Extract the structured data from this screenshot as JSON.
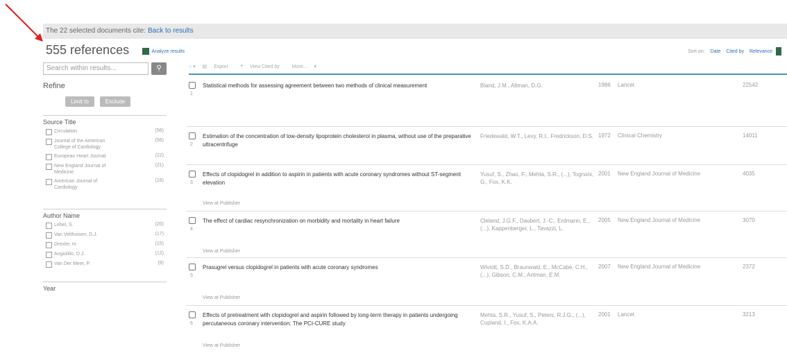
{
  "top_bar": {
    "text": "The 22 selected documents cite:",
    "link": "Back to results"
  },
  "header": {
    "count": "555 references",
    "analyze": "Analyze results"
  },
  "sort": {
    "label": "Sort on:",
    "options": [
      "Date",
      "Cited by",
      "Relevance"
    ]
  },
  "sidebar": {
    "search_placeholder": "Search within results...",
    "refine": "Refine",
    "limit_to": "Limit to",
    "exclude": "Exclude",
    "source_title": {
      "heading": "Source Title",
      "items": [
        {
          "name": "Circulation",
          "count": "(56)"
        },
        {
          "name": "Journal of the American College of Cardiology",
          "count": "(56)"
        },
        {
          "name": "European Heart Journal",
          "count": "(22)"
        },
        {
          "name": "New England Journal of Medicine",
          "count": "(21)"
        },
        {
          "name": "American Journal of Cardiology",
          "count": "(16)"
        }
      ]
    },
    "author_name": {
      "heading": "Author Name",
      "items": [
        {
          "name": "Lebel, S.",
          "count": "(20)"
        },
        {
          "name": "Van Velthuisen, D.J.",
          "count": "(17)"
        },
        {
          "name": "Drexler, H.",
          "count": "(15)"
        },
        {
          "name": "Angiolillo, D.J.",
          "count": "(12)"
        },
        {
          "name": "Van Der Meer, P.",
          "count": "(9)"
        }
      ]
    },
    "year_heading": "Year"
  },
  "toolbar": {
    "export": "Export",
    "view_cited_by": "View Cited by",
    "more": "More..."
  },
  "results": [
    {
      "num": "1",
      "title": "Statistical methods for assessing agreement between two methods of clinical measurement",
      "authors": "Bland, J.M., Altman, D.G.",
      "year": "1986",
      "source": "Lancet",
      "cited": "22542",
      "view": ""
    },
    {
      "num": "2",
      "title": "Estimation of the concentration of low-density lipoprotein cholesterol in plasma, without use of the preparative ultracentrifuge",
      "authors": "Friedewald, W.T., Levy, R.I., Fredrickson, D.S.",
      "year": "1972",
      "source": "Clinical Chemistry",
      "cited": "14011",
      "view": ""
    },
    {
      "num": "3",
      "title": "Effects of clopidogrel in addition to aspirin in patients with acute coronary syndromes without ST-segment elevation",
      "authors": "Yusuf, S., Zhao, F., Mehta, S.R., (...), Tognoni, G., Fox, K.K.",
      "year": "2001",
      "source": "New England Journal of Medicine",
      "cited": "4035",
      "view": "View at Publisher"
    },
    {
      "num": "4",
      "title": "The effect of cardiac resynchronization on morbidity and mortality in heart failure",
      "authors": "Cleland, J.G.F., Daubert, J.-C., Erdmann, E., (...), Kappenberger, L., Tavazzi, L.",
      "year": "2005",
      "source": "New England Journal of Medicine",
      "cited": "3070",
      "view": "View at Publisher"
    },
    {
      "num": "5",
      "title": "Prasugrel versus clopidogrel in patients with acute coronary syndromes",
      "authors": "Wiviott, S.D., Braunwald, E., McCabe, C.H., (...), Gibson, C.M., Antman, E.M.",
      "year": "2007",
      "source": "New England Journal of Medicine",
      "cited": "2372",
      "view": "View at Publisher"
    },
    {
      "num": "6",
      "title": "Effects of pretreatment with clopidogrel and aspirin followed by long-term therapy in patients undergoing percutaneous coronary intervention: The PCI-CURE study",
      "authors": "Mehta, S.R., Yusuf, S., Peters, R.J.G., (...), Copland, I., Fox, K.A.A.",
      "year": "2001",
      "source": "Lancet",
      "cited": "3213",
      "view": "View at Publisher"
    }
  ]
}
